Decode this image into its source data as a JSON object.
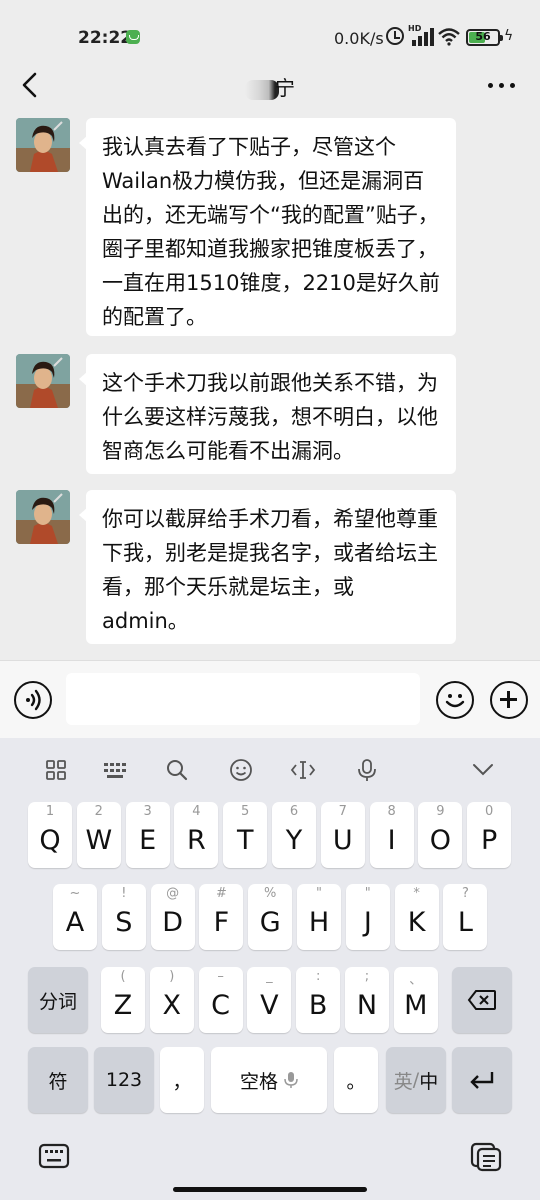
{
  "status_bar": {
    "time": "22:22",
    "net_speed": "0.0K/s",
    "network_label": "HD",
    "battery_level": 56
  },
  "header": {
    "title": "宁"
  },
  "messages": [
    {
      "sender": "contact",
      "text": "我认真去看了下贴子，尽管这个Wailan极力模仿我，但还是漏洞百出的，还无端写个“我的配置”贴子，圈子里都知道我搬家把锥度板丢了，一直在用1510锥度，2210是好久前的配置了。"
    },
    {
      "sender": "contact",
      "text": "这个手术刀我以前跟他关系不错，为什么要这样污蔑我，想不明白，以他智商怎么可能看不出漏洞。"
    },
    {
      "sender": "contact",
      "text": "你可以截屏给手术刀看，希望他尊重下我，别老是提我名字，或者给坛主看，那个天乐就是坛主，或admin。"
    }
  ],
  "input": {
    "value": "",
    "placeholder": ""
  },
  "keyboard": {
    "toolbar": [
      "grid-icon",
      "keyboard-layout-icon",
      "search-icon",
      "smiley-icon",
      "cursor-icon",
      "mic-icon",
      "collapse-icon"
    ],
    "row1": [
      {
        "k": "Q",
        "s": "1"
      },
      {
        "k": "W",
        "s": "2"
      },
      {
        "k": "E",
        "s": "3"
      },
      {
        "k": "R",
        "s": "4"
      },
      {
        "k": "T",
        "s": "5"
      },
      {
        "k": "Y",
        "s": "6"
      },
      {
        "k": "U",
        "s": "7"
      },
      {
        "k": "I",
        "s": "8"
      },
      {
        "k": "O",
        "s": "9"
      },
      {
        "k": "P",
        "s": "0"
      }
    ],
    "row2": [
      {
        "k": "A",
        "s": "~"
      },
      {
        "k": "S",
        "s": "!"
      },
      {
        "k": "D",
        "s": "@"
      },
      {
        "k": "F",
        "s": "#"
      },
      {
        "k": "G",
        "s": "%"
      },
      {
        "k": "H",
        "s": "\""
      },
      {
        "k": "J",
        "s": "\""
      },
      {
        "k": "K",
        "s": "*"
      },
      {
        "k": "L",
        "s": "?"
      }
    ],
    "row3": [
      {
        "k": "Z",
        "s": "("
      },
      {
        "k": "X",
        "s": ")"
      },
      {
        "k": "C",
        "s": "–"
      },
      {
        "k": "V",
        "s": "_"
      },
      {
        "k": "B",
        "s": ":"
      },
      {
        "k": "N",
        "s": ";"
      },
      {
        "k": "M",
        "s": "、"
      }
    ],
    "split_word": "分词",
    "symbols": "符",
    "numbers": "123",
    "comma": "，",
    "space": "空格",
    "period": "。",
    "lang_en": "英",
    "lang_sep": "/",
    "lang_zh": "中"
  },
  "colors": {
    "background": "#ededed",
    "bubble": "#ffffff",
    "keyboard": "#e8e9ee",
    "battery_green": "#4caf50"
  }
}
